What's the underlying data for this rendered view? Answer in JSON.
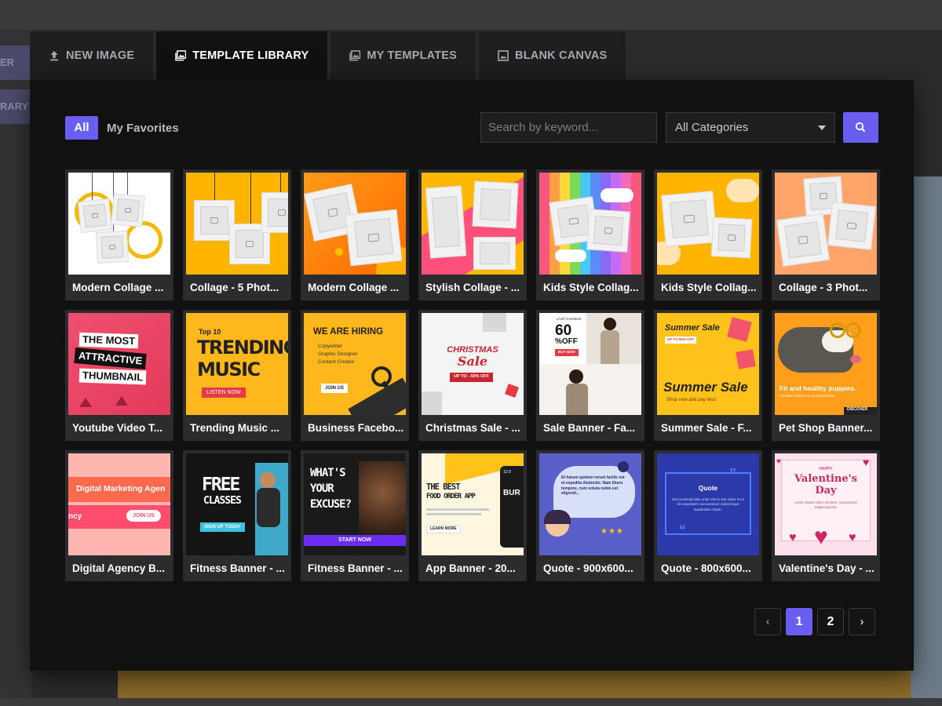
{
  "background": {
    "side_items": [
      "ER",
      "RARY"
    ]
  },
  "tabs": [
    {
      "label": "NEW IMAGE",
      "icon": "upload-icon",
      "active": false
    },
    {
      "label": "TEMPLATE LIBRARY",
      "icon": "images-icon",
      "active": true
    },
    {
      "label": "MY TEMPLATES",
      "icon": "images-icon",
      "active": false
    },
    {
      "label": "BLANK CANVAS",
      "icon": "image-icon",
      "active": false
    }
  ],
  "filters": {
    "all_label": "All",
    "favorites_label": "My Favorites",
    "search_placeholder": "Search by keyword...",
    "category_selected": "All Categories"
  },
  "templates": [
    {
      "label": "Modern Collage ..."
    },
    {
      "label": "Collage - 5 Phot..."
    },
    {
      "label": "Modern Collage ..."
    },
    {
      "label": "Stylish Collage - ..."
    },
    {
      "label": "Kids Style Collag..."
    },
    {
      "label": "Kids Style Collag..."
    },
    {
      "label": "Collage - 3 Phot..."
    },
    {
      "label": "Youtube Video T..."
    },
    {
      "label": "Trending Music ..."
    },
    {
      "label": "Business Facebo..."
    },
    {
      "label": "Christmas Sale - ..."
    },
    {
      "label": "Sale Banner - Fa..."
    },
    {
      "label": "Summer Sale - F..."
    },
    {
      "label": "Pet Shop Banner..."
    },
    {
      "label": "Digital Agency B..."
    },
    {
      "label": "Fitness Banner - ..."
    },
    {
      "label": "Fitness Banner - ..."
    },
    {
      "label": "App Banner - 20..."
    },
    {
      "label": "Quote - 900x600..."
    },
    {
      "label": "Quote - 800x600..."
    },
    {
      "label": "Valentine's Day - ..."
    }
  ],
  "thumb_text": {
    "yt": [
      "THE MOST",
      "ATTRACTIVE",
      "THUMBNAIL"
    ],
    "music_top": "Top 10",
    "music": [
      "TRENDING",
      "MUSIC"
    ],
    "music_btn": "LISTEN NOW",
    "hiring": "WE ARE HIRING",
    "hiring_list": [
      "Copywriter",
      "Graphic Designer",
      "Content Creator"
    ],
    "hiring_btn": "JOIN US",
    "xmas": "CHRISTMAS",
    "xmas_sale": "Sale",
    "xmas_off": "UP TO - 50% OFF",
    "sale_chance": "LAST CHANCE",
    "sale_60": "60",
    "sale_off": "%OFF",
    "sale_btn": "BUY NOW",
    "summer_top": "Summer Sale",
    "summer_off": "UP TO 50% OFF",
    "summer_big": "Summer Sale",
    "summer_sub": "Shop now and pay less!",
    "pet": "Fit and healthy puppies.",
    "pet_sub": "The best choice for your best friend",
    "pet_btn": "DISCOVER",
    "agency": "Digital Marketing Agen",
    "agency_left": "ncy",
    "agency_btn": "JOIN US",
    "fit1": [
      "FREE",
      "CLASSES"
    ],
    "fit1_btn": "SIGN UP TODAY",
    "fit2": [
      "WHAT'S",
      "YOUR",
      "EXCUSE?"
    ],
    "fit2_btn": "START NOW",
    "app": [
      "THE BEST",
      "FOOD ORDER APP"
    ],
    "app_btn": "LEARN MORE",
    "app_phone": "BUR",
    "app_time": "12:9",
    "quote1": "Et harum quidem rerum facilis est et expedita distinctio. Nam libero tempore, cum soluta nobis est eligendi...",
    "quote2_title": "Quote",
    "quote2": "Sed ut perspiciatis unde omnis iste natus error sit voluptatem accusantium doloremque laudantium totam.",
    "valentine_top": "HAPPY",
    "valentine": [
      "Valentine's",
      "Day"
    ],
    "valentine_sub": "Lorem ipsum dolor sit amet, consectetur adipiscing elit."
  },
  "pagination": {
    "prev": "‹",
    "pages": [
      "1",
      "2"
    ],
    "active": "1",
    "next": "›"
  },
  "colors": {
    "accent": "#6a5ef0"
  }
}
